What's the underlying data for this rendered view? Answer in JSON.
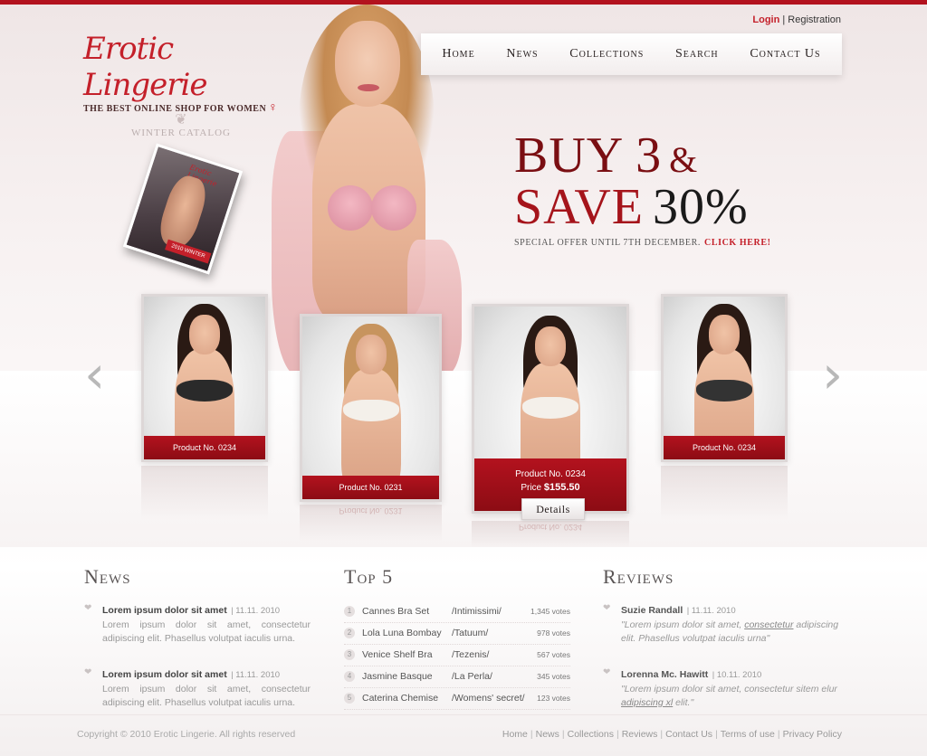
{
  "brand": {
    "title": "Erotic Lingerie",
    "tagline": "The best online shop for women",
    "accent_color": "#c4202a"
  },
  "auth": {
    "login": "Login",
    "separator": "|",
    "registration": "Registration"
  },
  "nav": {
    "items": [
      {
        "label": "Home"
      },
      {
        "label": "News"
      },
      {
        "label": "Collections"
      },
      {
        "label": "Search"
      },
      {
        "label": "Contact Us"
      }
    ]
  },
  "catalog": {
    "title": "Winter Catalog",
    "cover_logo": "Erotic Lingerie",
    "cover_ribbon": "2010 WINTER"
  },
  "offer": {
    "line1": "Buy 3",
    "amp": "&",
    "line2": "Save",
    "percent": "30%",
    "subtext": "SPECIAL OFFER UNTIL 7TH DECEMBER.",
    "cta": "CLICK HERE!"
  },
  "carousel": {
    "products": [
      {
        "label": "Product No. 0234"
      },
      {
        "label": "Product No. 0231"
      },
      {
        "label": "Product No. 0234",
        "price_label": "Price",
        "price": "$155.50",
        "details": "Details"
      },
      {
        "label": "Product No. 0234"
      }
    ],
    "reflect_text": "Product No. 0231",
    "reflect_text_2": "Product No. 0234"
  },
  "news": {
    "heading": "News",
    "items": [
      {
        "title": "Lorem ipsum dolor sit amet",
        "date": "| 11.11. 2010",
        "text": "Lorem ipsum dolor sit amet, consectetur adipiscing elit. Phasellus volutpat iaculis urna."
      },
      {
        "title": "Lorem ipsum dolor sit amet",
        "date": "| 11.11. 2010",
        "text": "Lorem ipsum dolor sit amet, consectetur adipiscing elit. Phasellus volutpat iaculis urna."
      }
    ]
  },
  "top5": {
    "heading": "Top 5",
    "items": [
      {
        "num": "1",
        "name": "Cannes Bra Set",
        "brand": "/Intimissimi/",
        "votes": "1,345 votes"
      },
      {
        "num": "2",
        "name": "Lola Luna Bombay",
        "brand": "/Tatuum/",
        "votes": "978 votes"
      },
      {
        "num": "3",
        "name": "Venice Shelf Bra",
        "brand": "/Tezenis/",
        "votes": "567 votes"
      },
      {
        "num": "4",
        "name": "Jasmine Basque",
        "brand": "/La Perla/",
        "votes": "345 votes"
      },
      {
        "num": "5",
        "name": "Caterina Chemise",
        "brand": "/Womens' secret/",
        "votes": "123 votes"
      }
    ]
  },
  "reviews": {
    "heading": "Reviews",
    "items": [
      {
        "name": "Suzie Randall",
        "date": "| 11.11. 2010",
        "text_before": "\"Lorem ipsum dolor sit amet, ",
        "text_link": "consectetur",
        "text_after": " adipiscing elit. Phasellus volutpat iaculis urna\""
      },
      {
        "name": "Lorenna Mc. Hawitt",
        "date": "| 10.11. 2010",
        "text_before": "\"Lorem ipsum dolor sit amet, consectetur sitem elur ",
        "text_link": "adipiscing xl",
        "text_after": " elit.\""
      }
    ]
  },
  "footer": {
    "copyright": "Copyright © 2010 Erotic Lingerie. All rights reserved",
    "links": [
      {
        "label": "Home"
      },
      {
        "label": "News"
      },
      {
        "label": "Collections"
      },
      {
        "label": "Reviews"
      },
      {
        "label": "Contact Us"
      },
      {
        "label": "Terms of use"
      },
      {
        "label": "Privacy Policy"
      }
    ],
    "separator": "|"
  }
}
